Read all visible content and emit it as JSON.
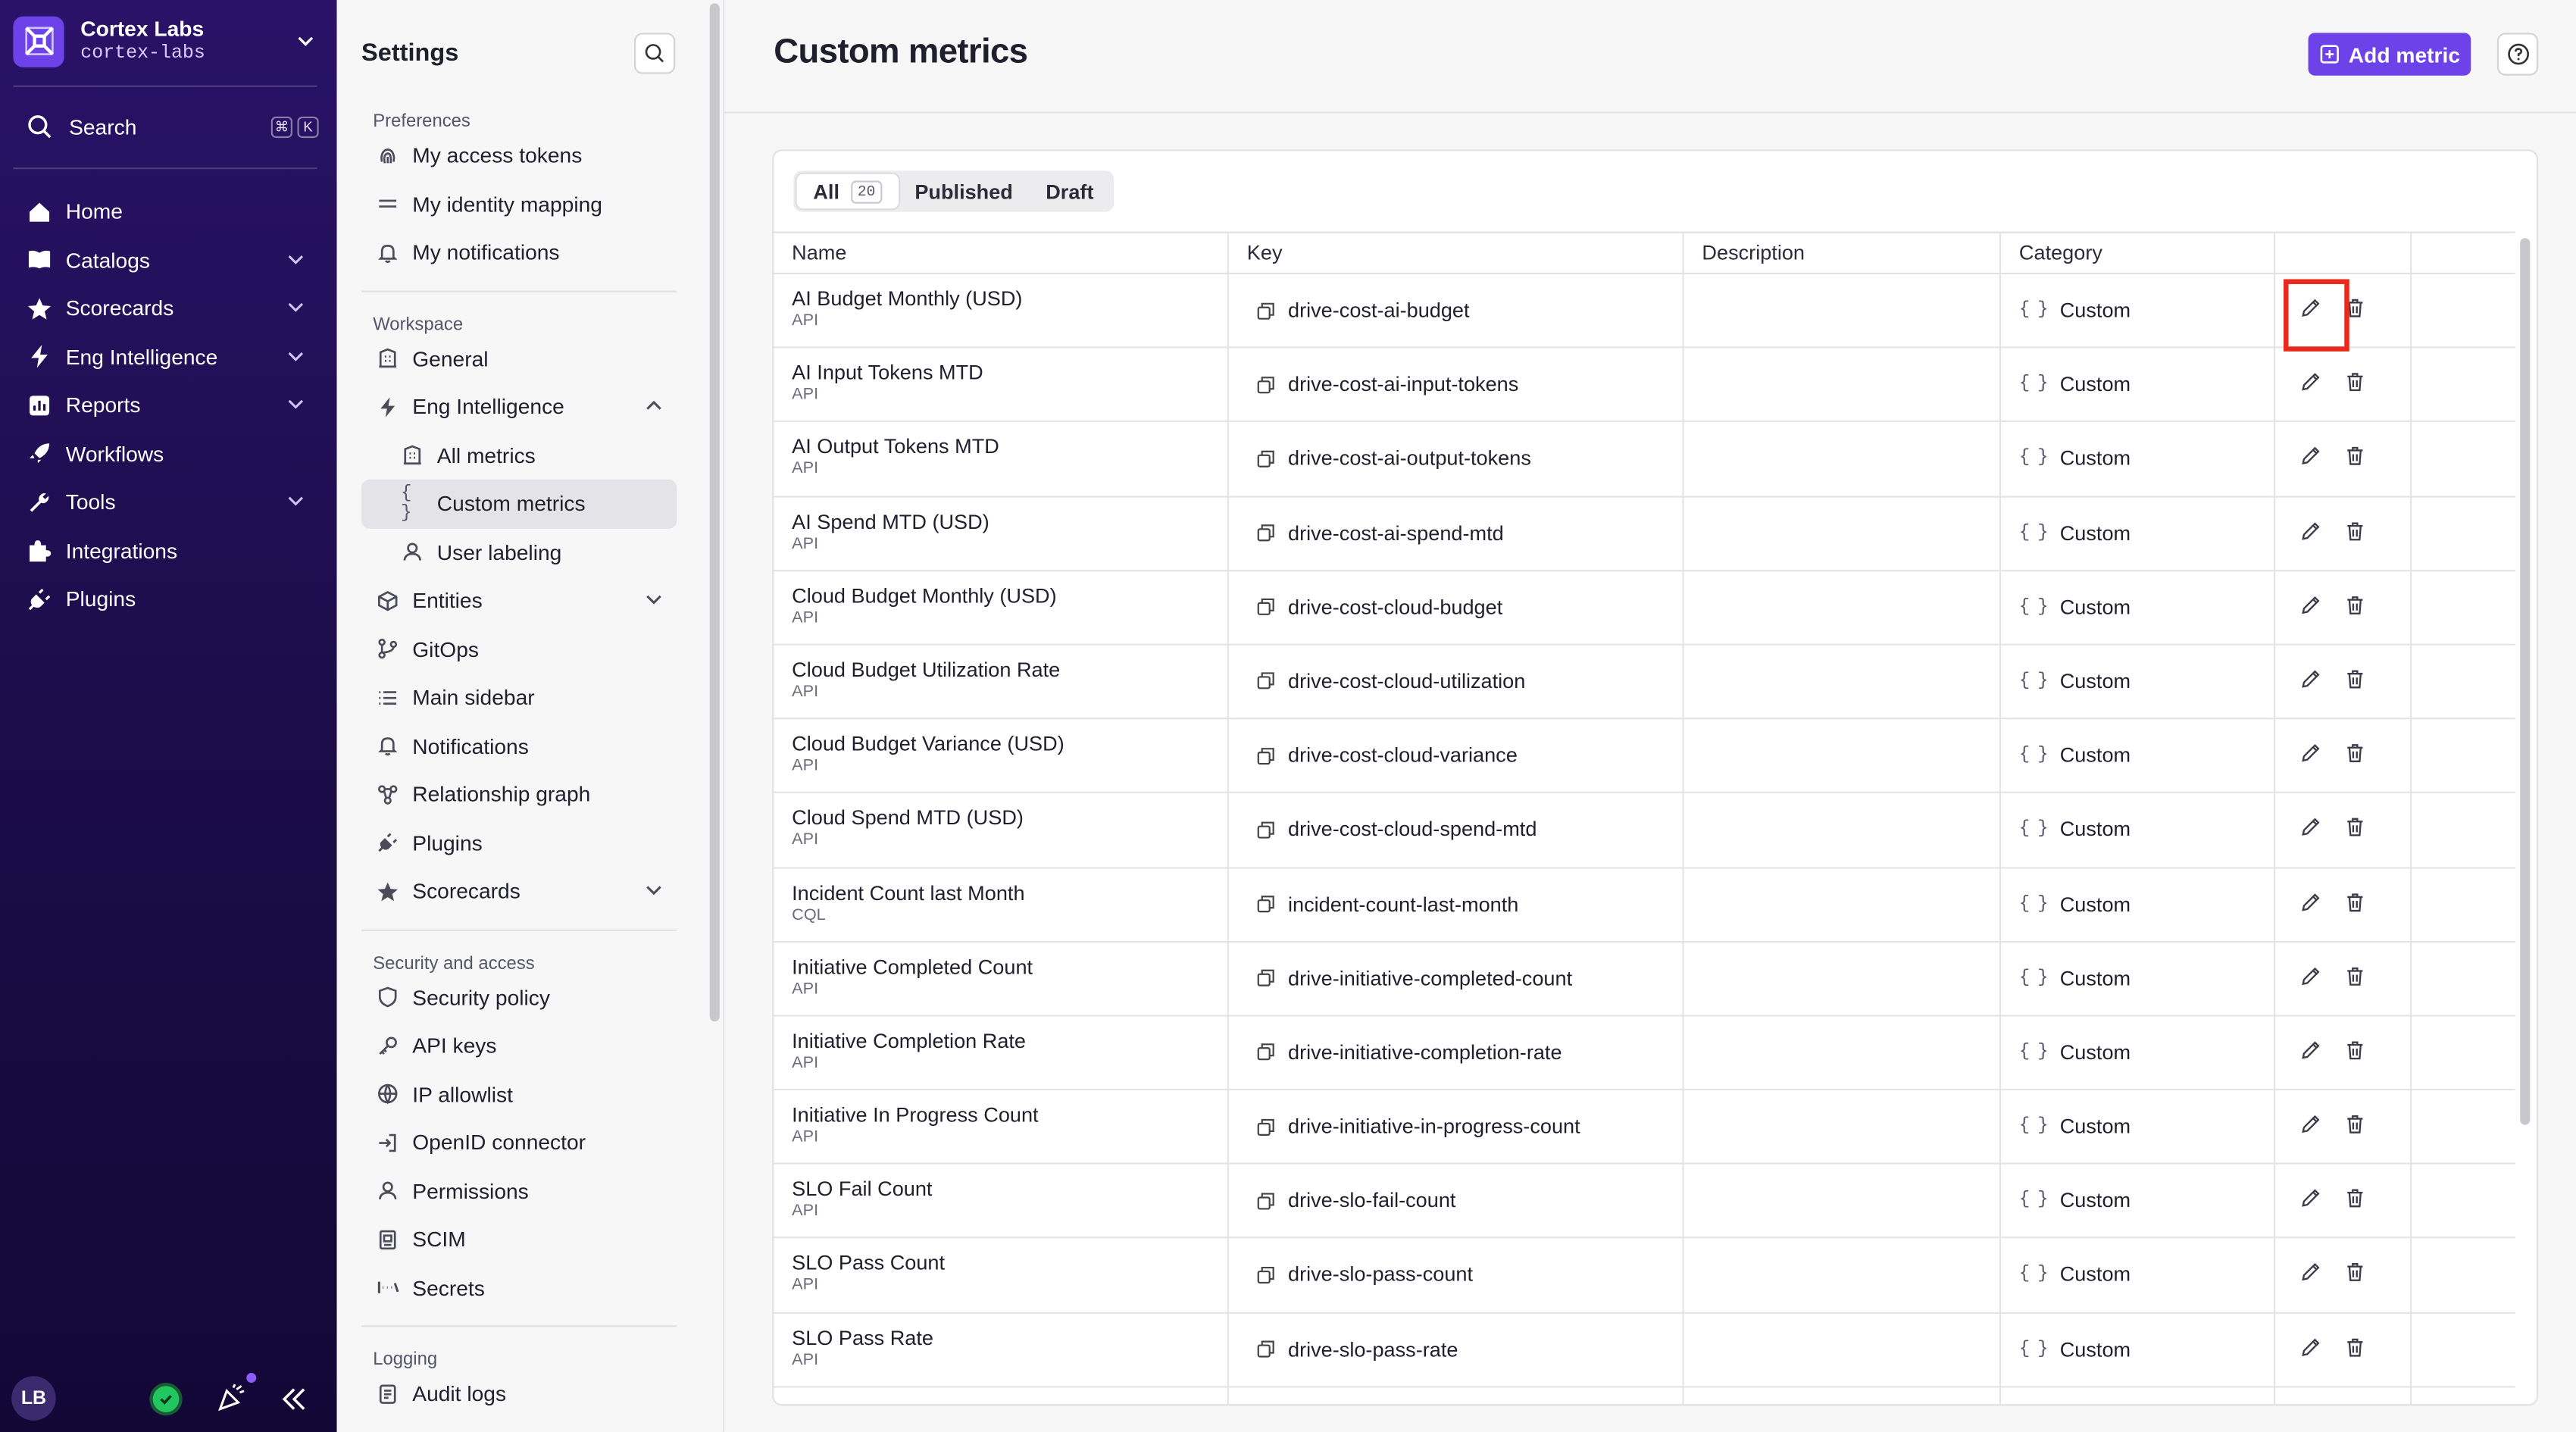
{
  "org": {
    "name": "Cortex Labs",
    "slug": "cortex-labs"
  },
  "nav": {
    "search_label": "Search",
    "search_keys": [
      "⌘",
      "K"
    ],
    "items": [
      {
        "label": "Home",
        "icon": "home-icon",
        "expandable": false
      },
      {
        "label": "Catalogs",
        "icon": "book-icon",
        "expandable": true
      },
      {
        "label": "Scorecards",
        "icon": "star-icon",
        "expandable": true
      },
      {
        "label": "Eng Intelligence",
        "icon": "lightning-icon",
        "expandable": true
      },
      {
        "label": "Reports",
        "icon": "chart-icon",
        "expandable": true
      },
      {
        "label": "Workflows",
        "icon": "rocket-icon",
        "expandable": false
      },
      {
        "label": "Tools",
        "icon": "wrench-icon",
        "expandable": true
      },
      {
        "label": "Integrations",
        "icon": "puzzle-icon",
        "expandable": false
      },
      {
        "label": "Plugins",
        "icon": "plug-icon",
        "expandable": false
      }
    ],
    "user_initials": "LB"
  },
  "settings": {
    "title": "Settings",
    "sections": [
      {
        "label": "Preferences",
        "items": [
          {
            "label": "My access tokens",
            "icon": "fingerprint-icon"
          },
          {
            "label": "My identity mapping",
            "icon": "equals-icon"
          },
          {
            "label": "My notifications",
            "icon": "bell-icon"
          }
        ]
      },
      {
        "label": "Workspace",
        "items": [
          {
            "label": "General",
            "icon": "building-icon"
          },
          {
            "label": "Eng Intelligence",
            "icon": "lightning-icon",
            "expanded": true
          },
          {
            "label": "All metrics",
            "icon": "building-icon",
            "sub": true
          },
          {
            "label": "Custom metrics",
            "icon": "braces-icon",
            "sub": true,
            "active": true
          },
          {
            "label": "User labeling",
            "icon": "user-icon",
            "sub": true
          },
          {
            "label": "Entities",
            "icon": "cube-icon",
            "collapsible": true
          },
          {
            "label": "GitOps",
            "icon": "git-icon"
          },
          {
            "label": "Main sidebar",
            "icon": "list-icon"
          },
          {
            "label": "Notifications",
            "icon": "bell-icon"
          },
          {
            "label": "Relationship graph",
            "icon": "graph-icon"
          },
          {
            "label": "Plugins",
            "icon": "plug-icon"
          },
          {
            "label": "Scorecards",
            "icon": "star-icon",
            "collapsible": true
          }
        ]
      },
      {
        "label": "Security and access",
        "items": [
          {
            "label": "Security policy",
            "icon": "shield-icon"
          },
          {
            "label": "API keys",
            "icon": "key-icon"
          },
          {
            "label": "IP allowlist",
            "icon": "globe-icon"
          },
          {
            "label": "OpenID connector",
            "icon": "login-icon"
          },
          {
            "label": "Permissions",
            "icon": "user-icon"
          },
          {
            "label": "SCIM",
            "icon": "scim-icon"
          },
          {
            "label": "Secrets",
            "icon": "secret-icon"
          }
        ]
      },
      {
        "label": "Logging",
        "items": [
          {
            "label": "Audit logs",
            "icon": "log-icon"
          }
        ]
      }
    ]
  },
  "page": {
    "title": "Custom metrics",
    "add_button": "Add metric",
    "tabs": [
      {
        "label": "All",
        "count": "20",
        "active": true
      },
      {
        "label": "Published"
      },
      {
        "label": "Draft"
      }
    ],
    "columns": [
      "Name",
      "Key",
      "Description",
      "Category"
    ]
  },
  "metrics": [
    {
      "name": "AI Budget Monthly (USD)",
      "type": "API",
      "key": "drive-cost-ai-budget",
      "description": "",
      "category": "Custom"
    },
    {
      "name": "AI Input Tokens MTD",
      "type": "API",
      "key": "drive-cost-ai-input-tokens",
      "description": "",
      "category": "Custom"
    },
    {
      "name": "AI Output Tokens MTD",
      "type": "API",
      "key": "drive-cost-ai-output-tokens",
      "description": "",
      "category": "Custom"
    },
    {
      "name": "AI Spend MTD (USD)",
      "type": "API",
      "key": "drive-cost-ai-spend-mtd",
      "description": "",
      "category": "Custom"
    },
    {
      "name": "Cloud Budget Monthly (USD)",
      "type": "API",
      "key": "drive-cost-cloud-budget",
      "description": "",
      "category": "Custom"
    },
    {
      "name": "Cloud Budget Utilization Rate",
      "type": "API",
      "key": "drive-cost-cloud-utilization",
      "description": "",
      "category": "Custom"
    },
    {
      "name": "Cloud Budget Variance (USD)",
      "type": "API",
      "key": "drive-cost-cloud-variance",
      "description": "",
      "category": "Custom"
    },
    {
      "name": "Cloud Spend MTD (USD)",
      "type": "API",
      "key": "drive-cost-cloud-spend-mtd",
      "description": "",
      "category": "Custom"
    },
    {
      "name": "Incident Count last Month",
      "type": "CQL",
      "key": "incident-count-last-month",
      "description": "",
      "category": "Custom"
    },
    {
      "name": "Initiative Completed Count",
      "type": "API",
      "key": "drive-initiative-completed-count",
      "description": "",
      "category": "Custom"
    },
    {
      "name": "Initiative Completion Rate",
      "type": "API",
      "key": "drive-initiative-completion-rate",
      "description": "",
      "category": "Custom"
    },
    {
      "name": "Initiative In Progress Count",
      "type": "API",
      "key": "drive-initiative-in-progress-count",
      "description": "",
      "category": "Custom"
    },
    {
      "name": "SLO Fail Count",
      "type": "API",
      "key": "drive-slo-fail-count",
      "description": "",
      "category": "Custom"
    },
    {
      "name": "SLO Pass Count",
      "type": "API",
      "key": "drive-slo-pass-count",
      "description": "",
      "category": "Custom"
    },
    {
      "name": "SLO Pass Rate",
      "type": "API",
      "key": "drive-slo-pass-rate",
      "description": "",
      "category": "Custom"
    }
  ],
  "highlighted_row": 0,
  "colors": {
    "accent": "#6d42e8",
    "nav_bg": "#1c0d4a",
    "highlight": "#e8291c"
  }
}
